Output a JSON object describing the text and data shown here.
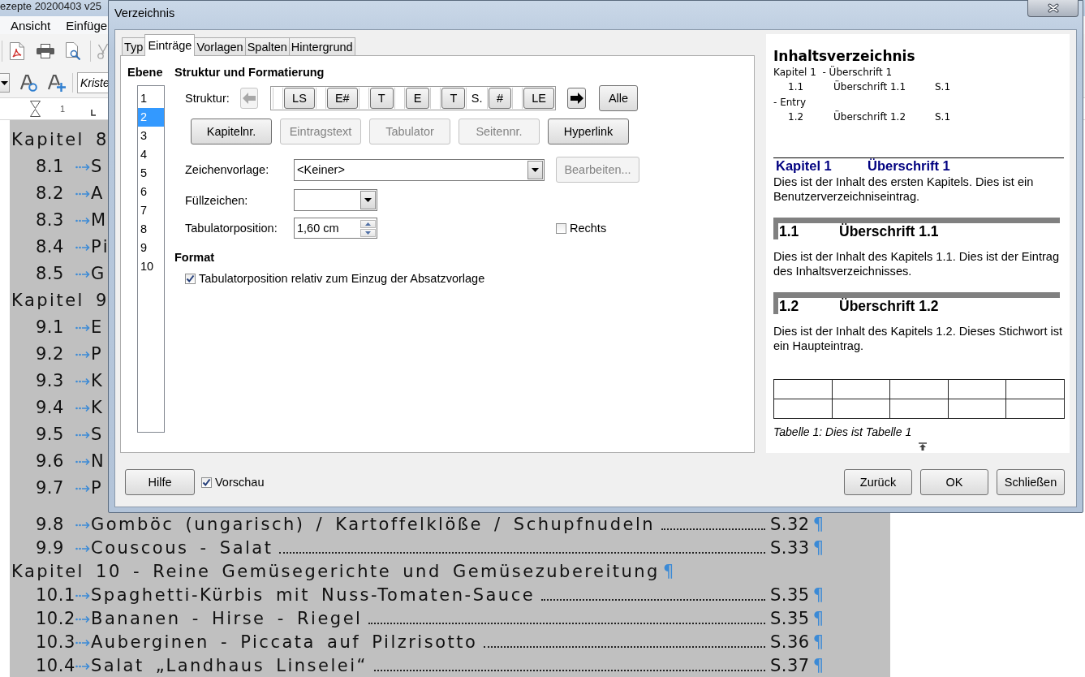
{
  "writer": {
    "title": "ezepte 20200403 v25",
    "menu": [
      "Ansicht",
      "Einfüge"
    ],
    "style_field": "Kriste",
    "ruler_labels": [
      "1"
    ],
    "document": {
      "lines": [
        {
          "kind": "chapter",
          "text": "Kapitel 8"
        },
        {
          "kind": "entry",
          "number": "8.1",
          "title": "S"
        },
        {
          "kind": "entry",
          "number": "8.2",
          "title": "A"
        },
        {
          "kind": "entry",
          "number": "8.3",
          "title": "M"
        },
        {
          "kind": "entry",
          "number": "8.4",
          "title": "Pi"
        },
        {
          "kind": "entry",
          "number": "8.5",
          "title": "G"
        },
        {
          "kind": "chapter",
          "text": "Kapitel 9"
        },
        {
          "kind": "entry",
          "number": "9.1",
          "title": "E"
        },
        {
          "kind": "entry",
          "number": "9.2",
          "title": "P"
        },
        {
          "kind": "entry",
          "number": "9.3",
          "title": "K"
        },
        {
          "kind": "entry",
          "number": "9.4",
          "title": "K"
        },
        {
          "kind": "entry",
          "number": "9.5",
          "title": "S"
        },
        {
          "kind": "entry",
          "number": "9.6",
          "title": "N"
        },
        {
          "kind": "entry",
          "number": "9.7",
          "title": "P"
        },
        {
          "kind": "entry",
          "number": "9.8",
          "title": "Gomböc (ungarisch) / Kartoffelklöße / Schupfnudeln",
          "page": "S.32",
          "mark": "¶"
        },
        {
          "kind": "entry",
          "number": "9.9",
          "title": "Couscous - Salat",
          "page": "S.33",
          "mark": "¶"
        },
        {
          "kind": "chapter",
          "text": "Kapitel 10 - Reine Gemüsegerichte und Gemüsezubereitung",
          "mark": "¶"
        },
        {
          "kind": "entry",
          "number": "10.1",
          "title": "Spaghetti-Kürbis mit Nuss-Tomaten-Sauce",
          "page": "S.35",
          "mark": "¶"
        },
        {
          "kind": "entry",
          "number": "10.2",
          "title": "Bananen - Hirse - Riegel",
          "page": "S.35",
          "mark": "¶"
        },
        {
          "kind": "entry",
          "number": "10.3",
          "title": "Auberginen - Piccata auf Pilzrisotto",
          "page": "S.36",
          "mark": "¶"
        },
        {
          "kind": "entry",
          "number": "10.4",
          "title": "Salat „Landhaus Linselei“",
          "page": "S.37",
          "mark": "¶"
        }
      ]
    }
  },
  "dialog": {
    "title": "Verzeichnis",
    "tabs": [
      {
        "label": "Typ",
        "selected": false
      },
      {
        "label": "Einträge",
        "selected": true
      },
      {
        "label": "Vorlagen",
        "selected": false
      },
      {
        "label": "Spalten",
        "selected": false
      },
      {
        "label": "Hintergrund",
        "selected": false
      }
    ],
    "levels": {
      "label": "Ebene",
      "items": [
        {
          "label": "1",
          "selected": false
        },
        {
          "label": "2",
          "selected": true
        },
        {
          "label": "3",
          "selected": false
        },
        {
          "label": "4",
          "selected": false
        },
        {
          "label": "5",
          "selected": false
        },
        {
          "label": "6",
          "selected": false
        },
        {
          "label": "7",
          "selected": false
        },
        {
          "label": "8",
          "selected": false
        },
        {
          "label": "9",
          "selected": false
        },
        {
          "label": "10",
          "selected": false
        }
      ]
    },
    "structure": {
      "title": "Struktur und Formatierung",
      "label": "Struktur:",
      "prev": {
        "disabled": true
      },
      "next": {
        "disabled": false
      },
      "elements": [
        {
          "kind": "slot"
        },
        {
          "kind": "token",
          "label": "LS"
        },
        {
          "kind": "slot"
        },
        {
          "kind": "token",
          "label": "E#"
        },
        {
          "kind": "slot"
        },
        {
          "kind": "token",
          "label": "T"
        },
        {
          "kind": "slot"
        },
        {
          "kind": "token",
          "label": "E"
        },
        {
          "kind": "slot"
        },
        {
          "kind": "token",
          "label": "T"
        },
        {
          "kind": "slot",
          "value": "S."
        },
        {
          "kind": "token",
          "label": "#"
        },
        {
          "kind": "slot"
        },
        {
          "kind": "token",
          "label": "LE"
        }
      ],
      "all_button": "Alle",
      "insert_buttons": [
        {
          "label": "Kapitelnr.",
          "disabled": false
        },
        {
          "label": "Eintragstext",
          "disabled": true
        },
        {
          "label": "Tabulator",
          "disabled": true
        },
        {
          "label": "Seitennr.",
          "disabled": true
        },
        {
          "label": "Hyperlink",
          "disabled": false
        }
      ]
    },
    "fields": [
      {
        "kind": "combo",
        "label": "Zeichenvorlage:",
        "value": "<Keiner>",
        "button": {
          "label": "Bearbeiten...",
          "disabled": true
        }
      },
      {
        "kind": "combo",
        "label": "Füllzeichen:"
      },
      {
        "kind": "spin",
        "label": "Tabulatorposition:",
        "value": "1,60 cm",
        "option": {
          "label": "Rechts",
          "checked": false
        }
      }
    ],
    "format": {
      "title": "Format",
      "options": [
        {
          "label": "Tabulatorposition relativ zum Einzug der Absatzvorlage",
          "checked": true
        }
      ]
    },
    "preview": {
      "toc_title": "Inhaltsverzeichnis",
      "toc_lines": [
        {
          "kind": "plain",
          "text": "Kapitel 1  - Überschrift 1"
        },
        {
          "kind": "entry",
          "number": "1.1",
          "title": "Überschrift 1.1",
          "page": "S.1"
        },
        {
          "kind": "plain",
          "text": "- Entry"
        },
        {
          "kind": "entry",
          "number": "1.2",
          "title": "Überschrift 1.2",
          "page": "S.1"
        }
      ],
      "sections": [
        {
          "kind": "chapter",
          "number": "Kapitel 1",
          "title": "Überschrift 1",
          "text": "Dies ist der Inhalt des ersten Kapitels. Dies ist ein Benutzerverzeichniseintrag."
        },
        {
          "kind": "heading",
          "number": "1.1",
          "title": "Überschrift 1.1",
          "text": "Dies ist der Inhalt des Kapitels 1.1. Dies ist der Eintrag des Inhaltsverzeichnisses."
        },
        {
          "kind": "heading",
          "number": "1.2",
          "title": "Überschrift 1.2",
          "text": "Dies ist der Inhalt des Kapitels 1.2. Dieses Stichwort ist ein Haupteintrag."
        }
      ],
      "caption": "Tabelle 1: Dies ist Tabelle 1"
    },
    "footer": {
      "help": "Hilfe",
      "preview_toggle": {
        "label": "Vorschau",
        "checked": true
      },
      "buttons": [
        "Zurück",
        "OK",
        "Schließen"
      ]
    }
  }
}
